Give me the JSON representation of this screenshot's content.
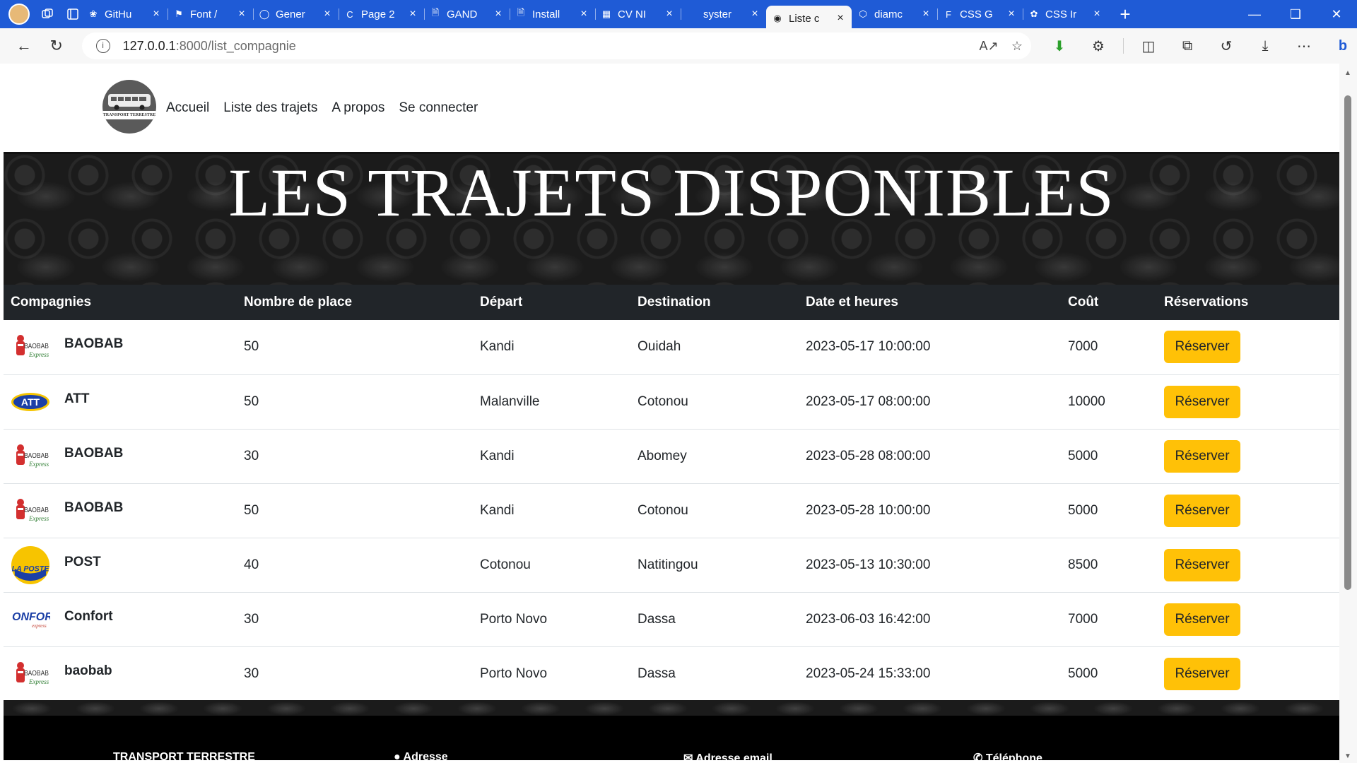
{
  "browser": {
    "tabs": [
      {
        "title": "GitHu",
        "icon": "chatgpt-icon"
      },
      {
        "title": "Font /",
        "icon": "flag-icon"
      },
      {
        "title": "Gener",
        "icon": "github-icon"
      },
      {
        "title": "Page 2",
        "icon": "c-icon"
      },
      {
        "title": "GAND",
        "icon": "doc-icon"
      },
      {
        "title": "Install",
        "icon": "doc-icon"
      },
      {
        "title": "CV NI",
        "icon": "pdf-icon"
      },
      {
        "title": "syster",
        "icon": "blank-icon"
      },
      {
        "title": "Liste c",
        "icon": "globe-icon",
        "active": true
      },
      {
        "title": "diamc",
        "icon": "codepen-icon"
      },
      {
        "title": "CSS G",
        "icon": "f-icon"
      },
      {
        "title": "CSS Ir",
        "icon": "leaf-icon"
      }
    ],
    "url_host": "127.0.0.1",
    "url_path": ":8000/list_compagnie",
    "close_glyph": "×",
    "new_tab_glyph": "+"
  },
  "site": {
    "logo_text": "TRANSPORT TERRESTRE",
    "nav": [
      "Accueil",
      "Liste des trajets",
      "A propos",
      "Se connecter"
    ],
    "hero_title": "LES TRAJETS DISPONIBLES"
  },
  "table": {
    "headers": [
      "Compagnies",
      "Nombre de place",
      "Départ",
      "Destination",
      "Date et heures",
      "Coût",
      "Réservations"
    ],
    "rows": [
      {
        "company": "BAOBAB",
        "logo": "baobab-logo",
        "places": "50",
        "depart": "Kandi",
        "destination": "Ouidah",
        "datetime": "2023-05-17 10:00:00",
        "cost": "7000",
        "action": "Réserver"
      },
      {
        "company": "ATT",
        "logo": "att-logo",
        "places": "50",
        "depart": "Malanville",
        "destination": "Cotonou",
        "datetime": "2023-05-17 08:00:00",
        "cost": "10000",
        "action": "Réserver"
      },
      {
        "company": "BAOBAB",
        "logo": "baobab-logo",
        "places": "30",
        "depart": "Kandi",
        "destination": "Abomey",
        "datetime": "2023-05-28 08:00:00",
        "cost": "5000",
        "action": "Réserver"
      },
      {
        "company": "BAOBAB",
        "logo": "baobab-logo",
        "places": "50",
        "depart": "Kandi",
        "destination": "Cotonou",
        "datetime": "2023-05-28 10:00:00",
        "cost": "5000",
        "action": "Réserver"
      },
      {
        "company": "POST",
        "logo": "laposte-logo",
        "places": "40",
        "depart": "Cotonou",
        "destination": "Natitingou",
        "datetime": "2023-05-13 10:30:00",
        "cost": "8500",
        "action": "Réserver"
      },
      {
        "company": "Confort",
        "logo": "confort-logo",
        "places": "30",
        "depart": "Porto Novo",
        "destination": "Dassa",
        "datetime": "2023-06-03 16:42:00",
        "cost": "7000",
        "action": "Réserver"
      },
      {
        "company": "baobab",
        "logo": "baobab-logo",
        "places": "30",
        "depart": "Porto Novo",
        "destination": "Dassa",
        "datetime": "2023-05-24 15:33:00",
        "cost": "5000",
        "action": "Réserver"
      }
    ]
  },
  "footer": {
    "items": [
      "TRANSPORT TERRESTRE",
      "Adresse",
      "Adresse email",
      "Téléphone"
    ]
  },
  "colors": {
    "tabbar": "#1f5bd6",
    "table_header": "#212529",
    "reserve_button": "#ffc107"
  }
}
